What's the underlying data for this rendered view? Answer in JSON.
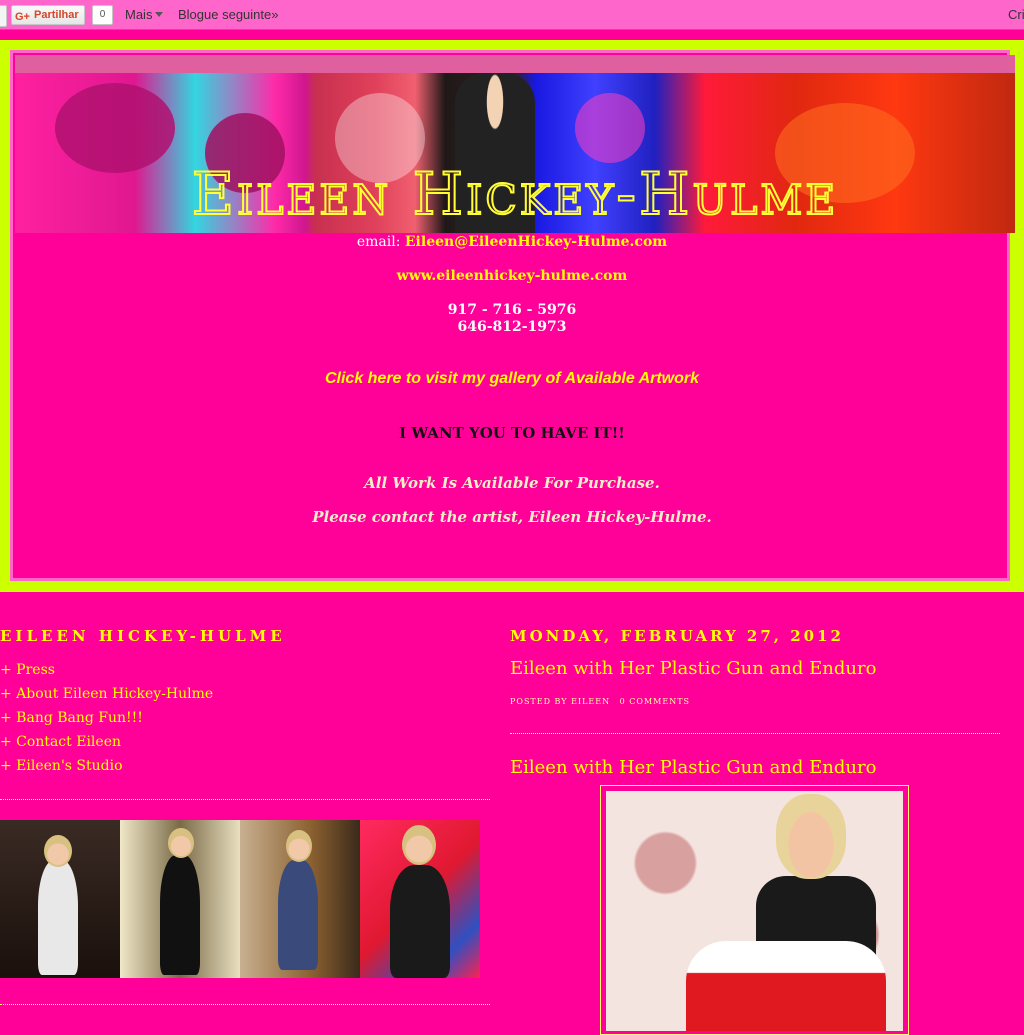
{
  "navbar": {
    "share_label": "Partilhar",
    "gplus_icon": "G+",
    "share_count": "0",
    "more_label": "Mais",
    "next_blog_label": "Blogue seguinte»",
    "create_label": "Cri"
  },
  "header": {
    "banner_title": "Eileen Hickey-Hulme",
    "email_prefix": "email: ",
    "email": "Eileen@EileenHickey-Hulme.com",
    "website": "www.eileenhickey-hulme.com",
    "phone1": "917 - 716 - 5976",
    "phone2": "646-812-1973",
    "gallery_link": "Click here to visit my gallery of Available Artwork",
    "want_line": "I WANT YOU TO HAVE IT!!",
    "available_line": "All Work Is Available For Purchase.",
    "contact_line": "Please contact the artist, Eileen Hickey-Hulme."
  },
  "sidebar": {
    "title": "EILEEN HICKEY-HULME",
    "links": [
      {
        "label": "+ Press"
      },
      {
        "label": "+ About Eileen Hickey-Hulme"
      },
      {
        "label": "+ Bang Bang Fun!!!"
      },
      {
        "label": "+ Contact Eileen"
      },
      {
        "label": "+ Eileen's Studio"
      }
    ]
  },
  "post": {
    "date": "MONDAY, FEBRUARY 27, 2012",
    "title": "Eileen with Her Plastic Gun and Enduro",
    "posted_by": "POSTED BY EILEEN",
    "comments": "0 COMMENTS",
    "body_title": "Eileen with Her Plastic Gun and Enduro"
  },
  "colors": {
    "page_bg": "#ff0099",
    "header_border": "#ccff00",
    "text_accent": "#ffff00",
    "navbar_bg": "#ff66cc"
  }
}
